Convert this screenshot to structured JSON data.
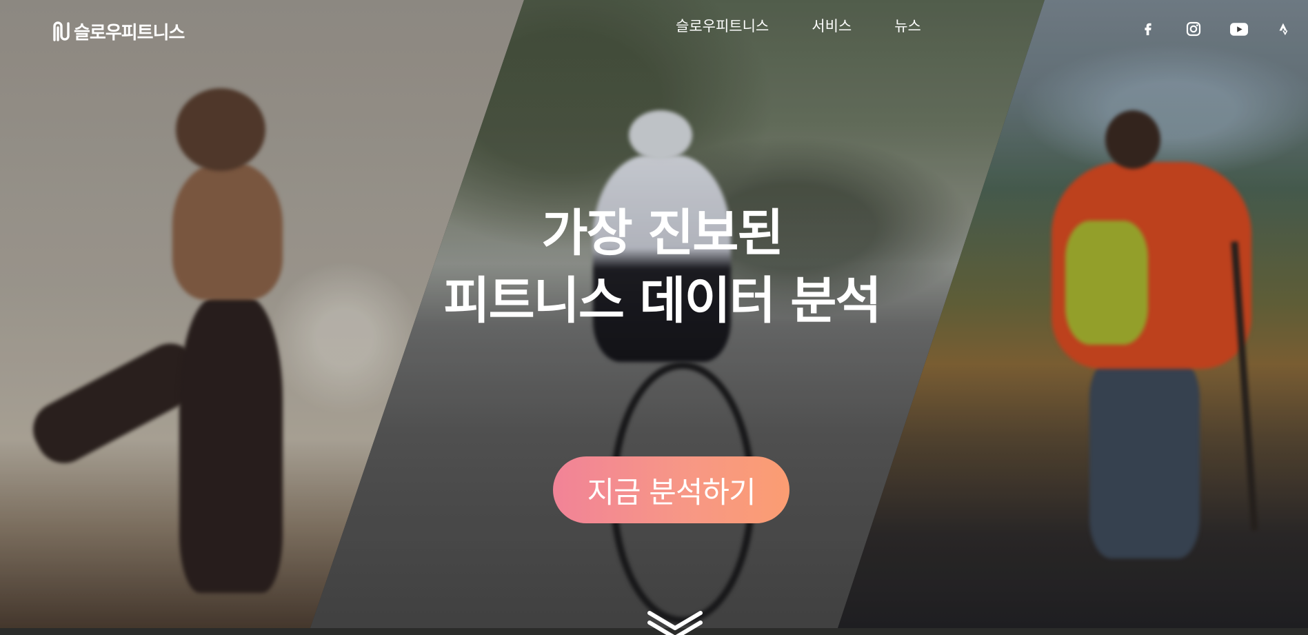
{
  "header": {
    "logo_text": "슬로우피트니스",
    "nav": [
      {
        "label": "슬로우피트니스"
      },
      {
        "label": "서비스"
      },
      {
        "label": "뉴스"
      }
    ],
    "social_icons": [
      "facebook-icon",
      "instagram-icon",
      "youtube-icon",
      "strava-icon"
    ]
  },
  "hero": {
    "headline_line1": "가장 진보된",
    "headline_line2": "피트니스 데이터 분석",
    "cta_label": "지금 분석하기",
    "scroll_icon": "chevron-down-icon"
  },
  "colors": {
    "cta_gradient_start": "#f18397",
    "cta_gradient_end": "#fb9d72",
    "text": "#ffffff"
  }
}
